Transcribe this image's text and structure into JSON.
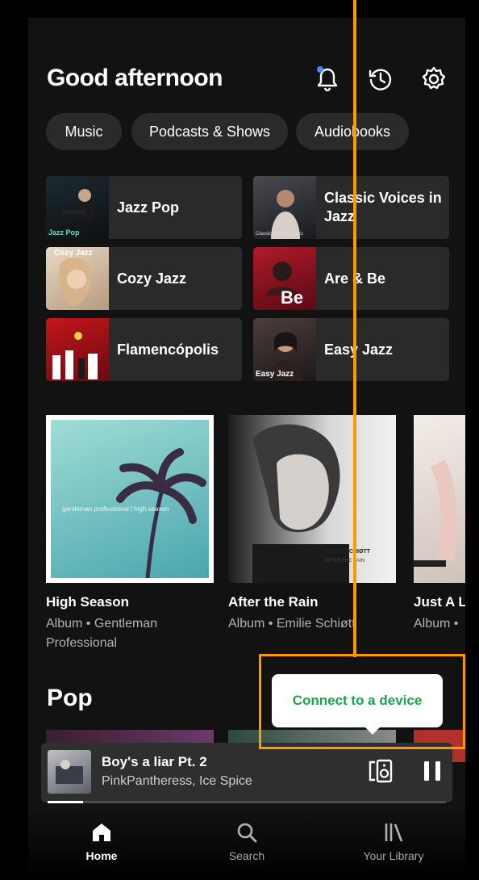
{
  "header": {
    "greeting": "Good afternoon"
  },
  "icons": {
    "bell": "bell-icon",
    "recent": "recent-history-icon",
    "settings": "gear-icon"
  },
  "chips": [
    {
      "label": "Music"
    },
    {
      "label": "Podcasts & Shows"
    },
    {
      "label": "Audiobooks"
    }
  ],
  "shortcuts": [
    {
      "label": "Jazz Pop"
    },
    {
      "label": "Classic Voices in Jazz"
    },
    {
      "label": "Cozy Jazz"
    },
    {
      "label": "Are & Be"
    },
    {
      "label": "Flamencópolis"
    },
    {
      "label": "Easy Jazz"
    }
  ],
  "art_text": {
    "jazz_pop": "Jazz Pop",
    "classic": "Classic Voices in Jazz",
    "cozy": "Cozy Jazz",
    "are_be": "Be",
    "easy": "Easy Jazz",
    "emilie": "EMILIE SCHIØTT",
    "emilie_sub": "AFTER THE RAIN",
    "gentleman": "gentleman professional | high season"
  },
  "albums": [
    {
      "title": "High Season",
      "subtitle": "Album • Gentleman Professional"
    },
    {
      "title": "After the Rain",
      "subtitle": "Album • Emilie Schiøtt"
    },
    {
      "title": "Just A L",
      "subtitle": "Album •"
    }
  ],
  "pop": {
    "title": "Pop"
  },
  "tooltip": {
    "label": "Connect to a device"
  },
  "now_playing": {
    "song": "Boy's a liar Pt. 2",
    "artist": "PinkPantheress, Ice Spice",
    "progress": 0.09
  },
  "nav": [
    {
      "label": "Home",
      "icon": "home-icon"
    },
    {
      "label": "Search",
      "icon": "search-icon"
    },
    {
      "label": "Your Library",
      "icon": "library-icon"
    }
  ],
  "colors": {
    "accent": "#1aa34a",
    "annotation": "#ff9900",
    "background": "#121212"
  }
}
